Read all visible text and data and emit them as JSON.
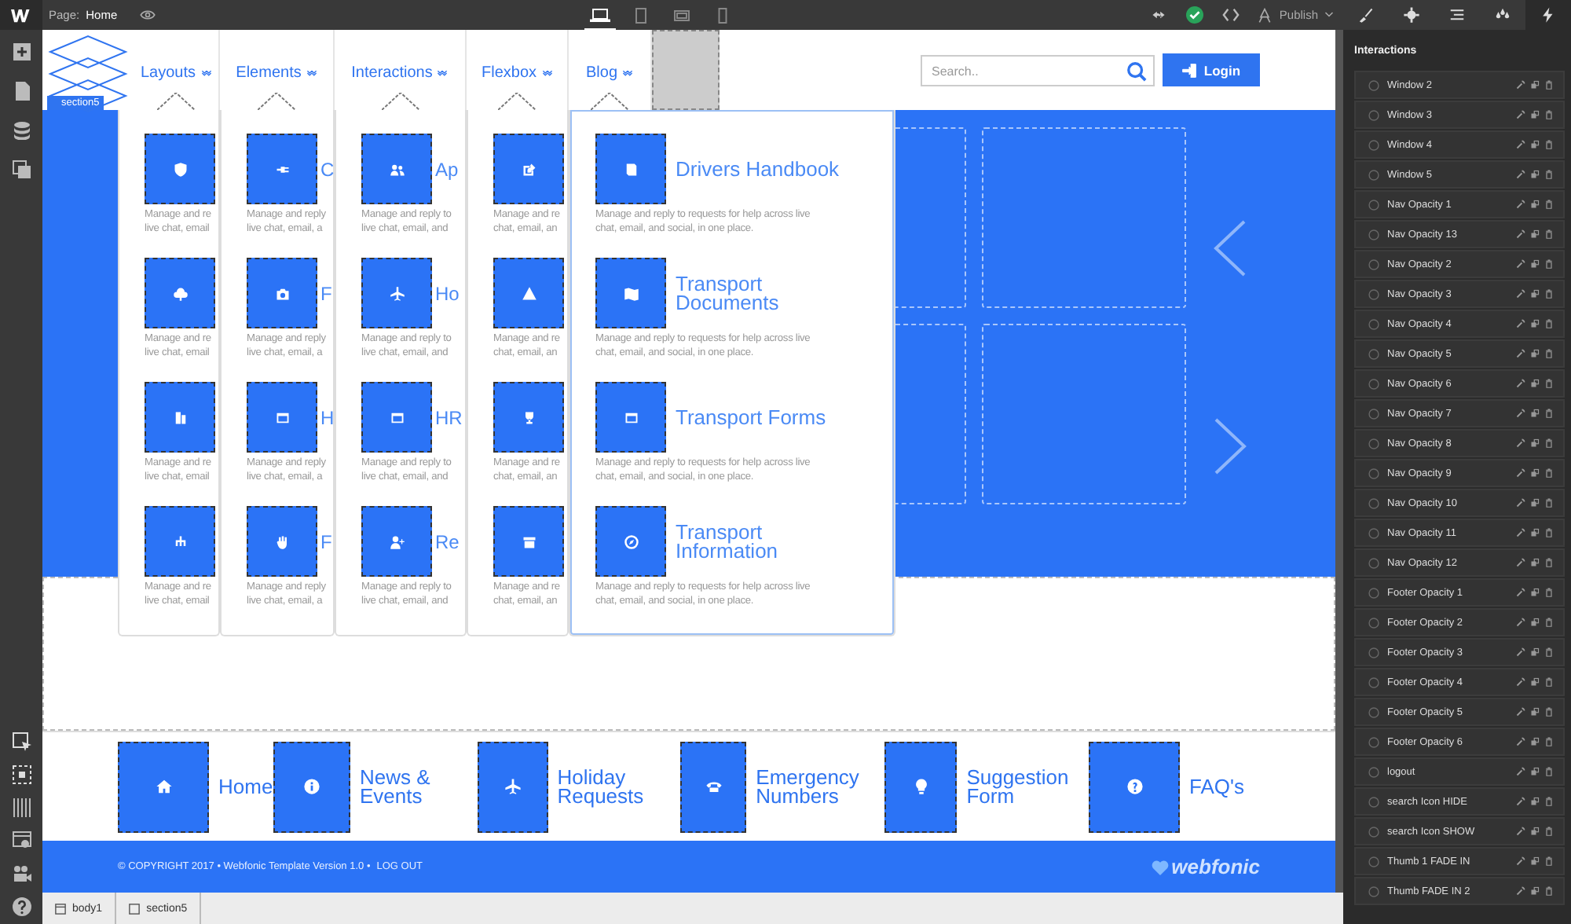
{
  "topbar": {
    "page_label": "Page:",
    "page_name": "Home",
    "publish": "Publish"
  },
  "devices": [
    {
      "selected": true
    },
    {
      "selected": false
    },
    {
      "selected": false
    },
    {
      "selected": false
    }
  ],
  "right_tabs": [
    {
      "selected": false
    },
    {
      "selected": false
    },
    {
      "selected": false
    },
    {
      "selected": false
    },
    {
      "selected": true
    }
  ],
  "nav": {
    "badge": "section5",
    "items": [
      {
        "label": "Layouts"
      },
      {
        "label": "Elements"
      },
      {
        "label": "Interactions"
      },
      {
        "label": "Flexbox"
      },
      {
        "label": "Blog"
      }
    ],
    "search": {
      "placeholder": "Search.."
    },
    "login": "Login"
  },
  "dropdown": {
    "panels": [
      {
        "items": [
          {
            "desc_lines": [
              "Manage and re",
              "live chat, email"
            ]
          },
          {
            "desc_lines": [
              "Manage and re",
              "live chat, email"
            ]
          },
          {
            "desc_lines": [
              "Manage and re",
              "live chat, email"
            ]
          },
          {
            "desc_lines": [
              "Manage and re",
              "live chat, email"
            ]
          }
        ]
      },
      {
        "items": [
          {
            "title": "C",
            "desc_lines": [
              "Manage and reply",
              "live chat, email, a"
            ]
          },
          {
            "title": "F",
            "desc_lines": [
              "Manage and reply",
              "live chat, email, a"
            ]
          },
          {
            "title": "H",
            "desc_lines": [
              "Manage and reply",
              "live chat, email, a"
            ]
          },
          {
            "title": "F",
            "desc_lines": [
              "Manage and reply",
              "live chat, email, a"
            ]
          }
        ]
      },
      {
        "items": [
          {
            "title": "Ap",
            "desc_lines": [
              "Manage and reply to",
              "live chat, email, and"
            ]
          },
          {
            "title": "Ho",
            "desc_lines": [
              "Manage and reply to",
              "live chat, email, and"
            ]
          },
          {
            "title": "HR",
            "desc_lines": [
              "Manage and reply to",
              "live chat, email, and"
            ]
          },
          {
            "title": "Re",
            "desc_lines": [
              "Manage and reply to",
              "live chat, email, and"
            ]
          }
        ]
      },
      {
        "items": [
          {
            "desc_lines": [
              "Manage and re",
              "chat, email, an"
            ]
          },
          {
            "desc_lines": [
              "Manage and re",
              "chat, email, an"
            ]
          },
          {
            "desc_lines": [
              "Manage and re",
              "chat, email, an"
            ]
          },
          {
            "desc_lines": [
              "Manage and re",
              "chat, email, an"
            ]
          }
        ]
      },
      {
        "items": [
          {
            "title": "Drivers Handbook",
            "desc_lines": [
              "Manage and reply to requests for help across live",
              "chat, email, and social, in one place."
            ]
          },
          {
            "title": "Transport Documents",
            "desc_lines": [
              "Manage and reply to requests for help across live",
              "chat, email, and social, in one place."
            ]
          },
          {
            "title": "Transport Forms",
            "desc_lines": [
              "Manage and reply to requests for help across live",
              "chat, email, and social, in one place."
            ]
          },
          {
            "title": "Transport Information",
            "desc_lines": [
              "Manage and reply to requests for help across live",
              "chat, email, and social, in one place."
            ]
          }
        ]
      }
    ]
  },
  "footer_links": [
    {
      "label": "Home"
    },
    {
      "label": "News & Events"
    },
    {
      "label": "Holiday Requests"
    },
    {
      "label": "Emergency Numbers"
    },
    {
      "label": "Suggestion Form"
    },
    {
      "label": "FAQ's"
    }
  ],
  "footer": {
    "copyright": "© COPYRIGHT 2017 • Webfonic Template Version 1.0 •",
    "logout": "LOG OUT",
    "brand": "webfonic"
  },
  "panel": {
    "title": "Interactions",
    "items": [
      {
        "label": "Window 2"
      },
      {
        "label": "Window 3"
      },
      {
        "label": "Window 4"
      },
      {
        "label": "Window 5"
      },
      {
        "label": "Nav Opacity 1"
      },
      {
        "label": "Nav Opacity 13"
      },
      {
        "label": "Nav Opacity 2"
      },
      {
        "label": "Nav Opacity 3"
      },
      {
        "label": "Nav Opacity 4"
      },
      {
        "label": "Nav Opacity 5"
      },
      {
        "label": "Nav Opacity 6"
      },
      {
        "label": "Nav Opacity 7"
      },
      {
        "label": "Nav Opacity 8"
      },
      {
        "label": "Nav Opacity 9"
      },
      {
        "label": "Nav Opacity 10"
      },
      {
        "label": "Nav Opacity 11"
      },
      {
        "label": "Nav Opacity 12"
      },
      {
        "label": "Footer Opacity 1"
      },
      {
        "label": "Footer Opacity 2"
      },
      {
        "label": "Footer Opacity 3"
      },
      {
        "label": "Footer Opacity 4"
      },
      {
        "label": "Footer Opacity 5"
      },
      {
        "label": "Footer Opacity 6"
      },
      {
        "label": "logout"
      },
      {
        "label": "search Icon HIDE"
      },
      {
        "label": "search Icon SHOW"
      },
      {
        "label": "Thumb 1 FADE IN"
      },
      {
        "label": "Thumb FADE IN 2"
      }
    ]
  },
  "breadcrumb": [
    {
      "label": "body1"
    },
    {
      "label": "section5"
    }
  ]
}
